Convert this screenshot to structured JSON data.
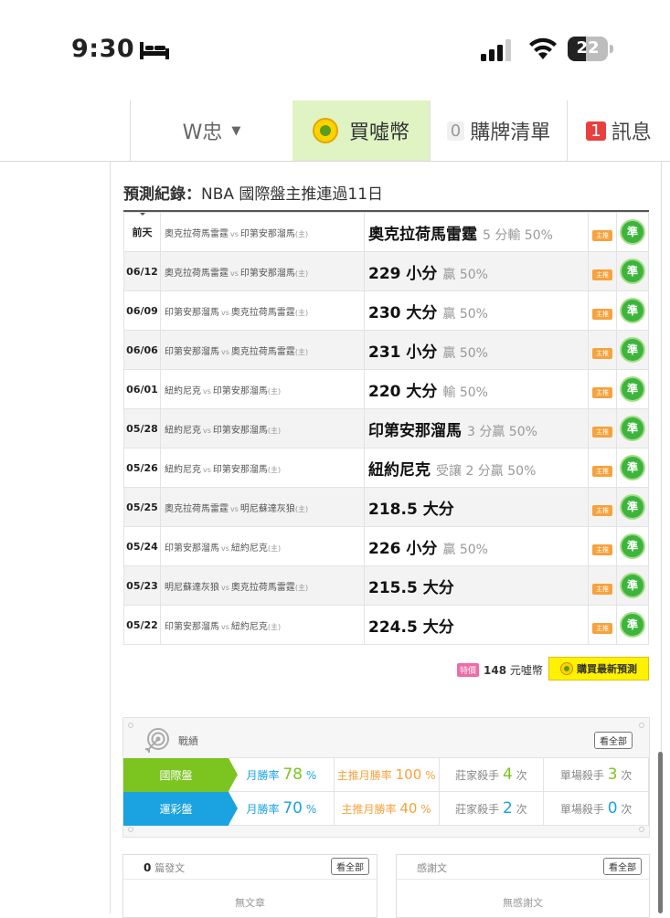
{
  "status": {
    "time": "9:30",
    "battery": "22"
  },
  "nav": {
    "user": "W忠",
    "buy": "買噓幣",
    "cart_count": "0",
    "cart": "購牌清單",
    "msg_count": "1",
    "msg": "訊息"
  },
  "predictions": {
    "title_bold": "預測紀錄：",
    "title_rest": "NBA 國際盤主推連過11日",
    "tag": "主推",
    "ok": "準",
    "vs": "vs",
    "home": "(主)",
    "rows": [
      {
        "date": "前天",
        "team_a": "奧克拉荷馬雷霆",
        "team_b": "印第安那溜馬",
        "pick": "奧克拉荷馬雷霆",
        "result": "5 分輸 50%"
      },
      {
        "date": "06/12",
        "team_a": "奧克拉荷馬雷霆",
        "team_b": "印第安那溜馬",
        "pick": "229 小分",
        "result": "贏 50%"
      },
      {
        "date": "06/09",
        "team_a": "印第安那溜馬",
        "team_b": "奧克拉荷馬雷霆",
        "pick": "230 大分",
        "result": "贏 50%"
      },
      {
        "date": "06/06",
        "team_a": "印第安那溜馬",
        "team_b": "奧克拉荷馬雷霆",
        "pick": "231 小分",
        "result": "贏 50%"
      },
      {
        "date": "06/01",
        "team_a": "紐約尼克",
        "team_b": "印第安那溜馬",
        "pick": "220 大分",
        "result": "輸 50%"
      },
      {
        "date": "05/28",
        "team_a": "紐約尼克",
        "team_b": "印第安那溜馬",
        "pick": "印第安那溜馬",
        "result": "3 分贏 50%"
      },
      {
        "date": "05/26",
        "team_a": "紐約尼克",
        "team_b": "印第安那溜馬",
        "pick": "紐約尼克",
        "result": "受讓 2 分贏 50%"
      },
      {
        "date": "05/25",
        "team_a": "奧克拉荷馬雷霆",
        "team_b": "明尼蘇達灰狼",
        "pick": "218.5 大分",
        "result": ""
      },
      {
        "date": "05/24",
        "team_a": "印第安那溜馬",
        "team_b": "紐約尼克",
        "pick": "226 小分",
        "result": "贏 50%"
      },
      {
        "date": "05/23",
        "team_a": "明尼蘇達灰狼",
        "team_b": "奧克拉荷馬雷霆",
        "pick": "215.5 大分",
        "result": ""
      },
      {
        "date": "05/22",
        "team_a": "印第安那溜馬",
        "team_b": "紐約尼克",
        "pick": "224.5 大分",
        "result": ""
      }
    ]
  },
  "purchase": {
    "special": "特價",
    "price": "148",
    "unit": "元噓幣",
    "button": "購買最新預測"
  },
  "record": {
    "title": "戰績",
    "see_all": "看全部",
    "rows": [
      {
        "label": "國際盤",
        "monthly_label": "月勝率",
        "monthly": "78",
        "main_label": "主推月勝率",
        "main": "100",
        "pct": "%",
        "banker_label": "莊家殺手",
        "banker": "4",
        "single_label": "單場殺手",
        "single": "3",
        "times": "次"
      },
      {
        "label": "運彩盤",
        "monthly_label": "月勝率",
        "monthly": "70",
        "main_label": "主推月勝率",
        "main": "40",
        "pct": "%",
        "banker_label": "莊家殺手",
        "banker": "2",
        "single_label": "單場殺手",
        "single": "0",
        "times": "次"
      }
    ]
  },
  "posts": {
    "count": "0",
    "label": "篇發文",
    "see_all": "看全部",
    "empty": "無文章"
  },
  "thanks": {
    "label": "感謝文",
    "see_all": "看全部",
    "empty": "無感謝文"
  }
}
